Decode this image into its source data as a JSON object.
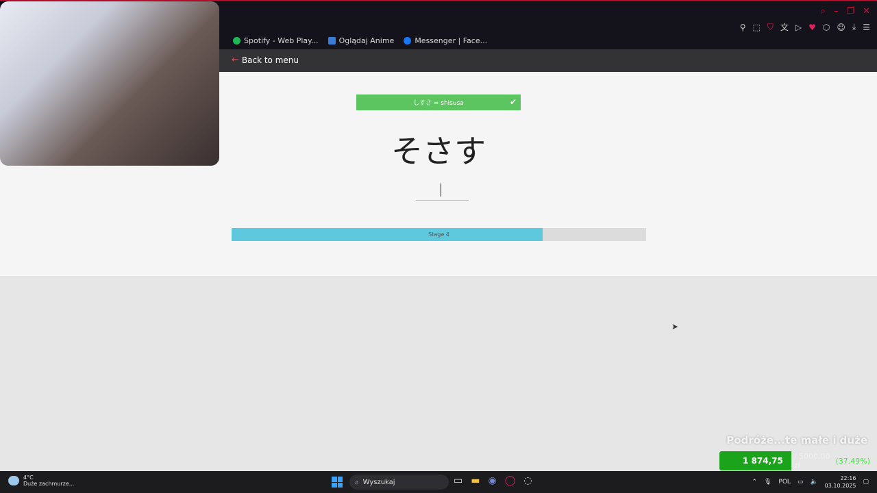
{
  "browser": {
    "bookmarks": [
      {
        "label": "Spotify - Web Play...",
        "color": "#1db954"
      },
      {
        "label": "Oglądaj Anime",
        "color": "#3a7bd5"
      },
      {
        "label": "Messenger | Face...",
        "color": "#1877f2"
      }
    ],
    "toolbar_icons": [
      "pin-icon",
      "snapshot-icon",
      "pocket-icon",
      "translate-icon",
      "play-icon",
      "heart-icon",
      "extensions-icon",
      "profile-icon",
      "download-icon",
      "menu-icon"
    ]
  },
  "app": {
    "back_label": "Back to menu",
    "feedback": "しすさ = shisusa",
    "feedback_color": "#5cc55f",
    "prompt_kana": "そさす",
    "answer_value": "",
    "stage_label": "Stage 4",
    "progress_percent": 75,
    "progress_color": "#5ec8dc"
  },
  "donation": {
    "title": "Podróże...te małe i duże",
    "amount": "1 874,75 zł",
    "goal": "/ 5000,00 zł",
    "percent": "(37.49%)"
  },
  "taskbar": {
    "weather_temp": "4°C",
    "weather_desc": "Duże zachmurze...",
    "search_placeholder": "Wyszukaj",
    "lang": "POL",
    "time": "22:16",
    "date": "03.10.2025"
  }
}
